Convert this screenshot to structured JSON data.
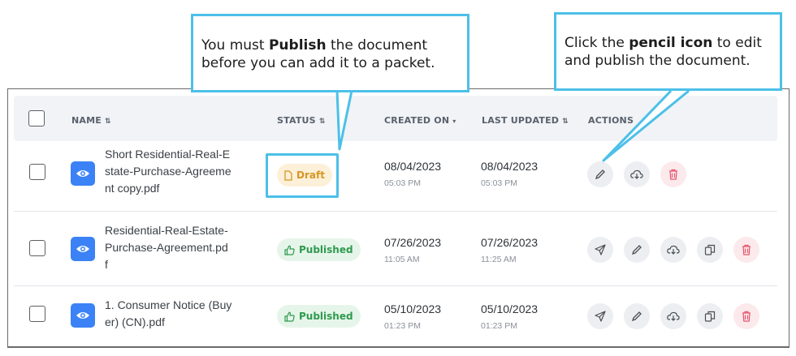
{
  "callouts": {
    "publish": {
      "pre": "You must ",
      "bold": "Publish",
      "post": " the document before you can add it to a packet."
    },
    "pencil": {
      "pre": "Click the ",
      "bold": "pencil icon",
      "post": " to edit and publish the document."
    }
  },
  "table": {
    "headers": {
      "name": "NAME",
      "status": "STATUS",
      "created": "CREATED ON",
      "updated": "LAST UPDATED",
      "actions": "ACTIONS"
    },
    "rows": [
      {
        "name": "Short Residential-Real-E\nstate-Purchase-Agreeme\nnt copy.pdf",
        "status": "Draft",
        "created_date": "08/04/2023",
        "created_time": "05:03 PM",
        "updated_date": "08/04/2023",
        "updated_time": "05:03 PM",
        "actions": [
          "edit",
          "download",
          "delete"
        ]
      },
      {
        "name": "Residential-Real-Estate-\nPurchase-Agreement.pd\nf",
        "status": "Published",
        "created_date": "07/26/2023",
        "created_time": "11:05 AM",
        "updated_date": "07/26/2023",
        "updated_time": "11:25 AM",
        "actions": [
          "send",
          "edit",
          "download",
          "duplicate",
          "delete"
        ]
      },
      {
        "name": "1. Consumer Notice (Buy\ner) (CN).pdf",
        "status": "Published",
        "created_date": "05/10/2023",
        "created_time": "01:23 PM",
        "updated_date": "05/10/2023",
        "updated_time": "01:23 PM",
        "actions": [
          "send",
          "edit",
          "download",
          "duplicate",
          "delete"
        ]
      }
    ]
  },
  "colors": {
    "accent": "#4cc0e8",
    "eye_button": "#3b82f6",
    "draft": "#d69622",
    "published": "#2e9a4e",
    "delete": "#e5546a"
  },
  "icons": {
    "sort": "sort-updown-icon",
    "sort_desc": "sort-desc-icon",
    "eye": "eye-icon",
    "draft": "document-icon",
    "published": "thumbs-up-icon",
    "send": "paper-plane-icon",
    "edit": "pencil-icon",
    "download": "cloud-download-icon",
    "duplicate": "copy-icon",
    "delete": "trash-icon"
  }
}
